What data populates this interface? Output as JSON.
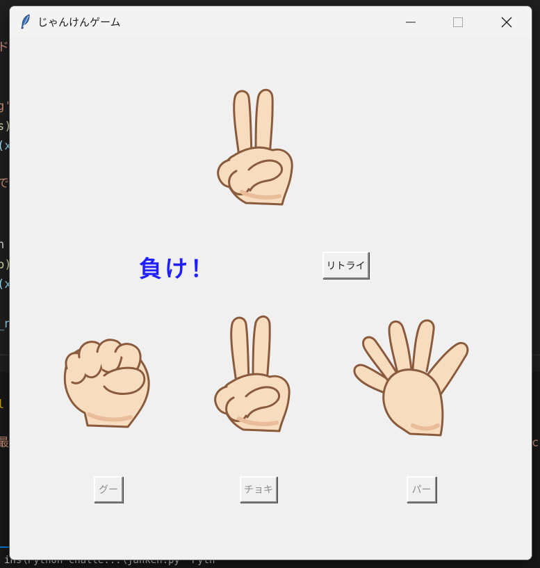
{
  "window": {
    "title": "じゃんけんゲーム",
    "controls": {
      "minimize": "minimize",
      "maximize": "maximize",
      "close": "close"
    }
  },
  "computer_hand": {
    "name": "scissors",
    "icon": "peace-hand-icon"
  },
  "result": {
    "text": "負け！",
    "color": "#1f1fff"
  },
  "retry_button": {
    "label": "リトライ",
    "enabled": true
  },
  "choices": [
    {
      "label": "グー",
      "icon": "fist-hand-icon",
      "enabled": false
    },
    {
      "label": "チョキ",
      "icon": "peace-hand-icon",
      "enabled": false
    },
    {
      "label": "パー",
      "icon": "open-hand-icon",
      "enabled": false
    }
  ],
  "background_editor": {
    "fragments_left": [
      "ド三",
      "g'",
      "s)",
      "(x",
      "で_",
      "n",
      "p)",
      "(x",
      "_n",
      "l",
      "最"
    ],
    "fragment_right": "c",
    "status_text": "ins\\Python challe...\\janken.py  Pyth"
  },
  "colors": {
    "skin": "#f7dcc0",
    "outline": "#8a5a3c"
  }
}
